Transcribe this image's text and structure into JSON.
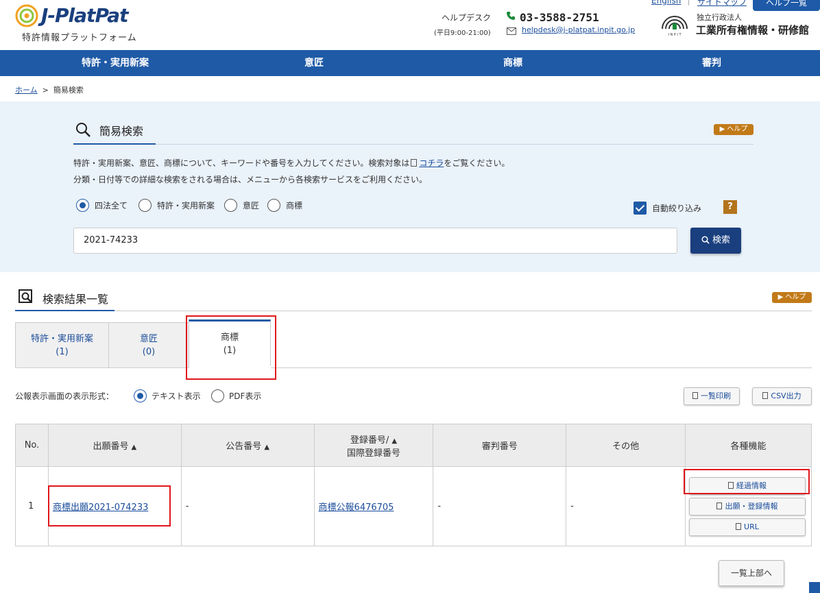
{
  "header": {
    "logo_text": "J-PlatPat",
    "logo_sub": "特許情報プラットフォーム",
    "helpdesk_label": "ヘルプデスク",
    "helpdesk_hours": "(平日9:00-21:00)",
    "phone": "03-3588-2751",
    "email": "helpdesk@j-platpat.inpit.go.jp",
    "top_link_1": "English",
    "top_link_2": "サイトマップ",
    "top_button": "ヘルプ一覧",
    "org_type": "独立行政法人",
    "org_name": "工業所有権情報・研修館"
  },
  "nav": {
    "items": [
      {
        "label": "特許・実用新案"
      },
      {
        "label": "意匠"
      },
      {
        "label": "商標"
      },
      {
        "label": "審判"
      }
    ]
  },
  "breadcrumb": {
    "home": "ホーム",
    "sep": ">",
    "current": "簡易検索"
  },
  "search": {
    "title": "簡易検索",
    "help": "▶ ヘルプ",
    "desc1_pre": "特許・実用新案、意匠、商標について、キーワードや番号を入力してください。検索対象は",
    "desc1_link": "コチラ",
    "desc1_post": "をご覧ください。",
    "desc2": "分類・日付等での詳細な検索をされる場合は、メニューから各検索サービスをご利用ください。",
    "radios": [
      {
        "label": "四法全て",
        "selected": true
      },
      {
        "label": "特許・実用新案",
        "selected": false
      },
      {
        "label": "意匠",
        "selected": false
      },
      {
        "label": "商標",
        "selected": false
      }
    ],
    "auto_narrow_label": "自動絞り込み",
    "auto_narrow_checked": true,
    "question": "?",
    "query": "2021-74233",
    "button": "検索"
  },
  "results": {
    "title": "検索結果一覧",
    "help": "▶ ヘルプ",
    "tabs": [
      {
        "label": "特許・実用新案",
        "count": "(1)",
        "active": false
      },
      {
        "label": "意匠",
        "count": "(0)",
        "active": false
      },
      {
        "label": "商標",
        "count": "(1)",
        "active": true
      }
    ],
    "format_label": "公報表示画面の表示形式：",
    "format_options": [
      {
        "label": "テキスト表示",
        "selected": true
      },
      {
        "label": "PDF表示",
        "selected": false
      }
    ],
    "print_button": "一覧印刷",
    "csv_button": "CSV出力",
    "columns": [
      "No.",
      "出願番号",
      "公告番号",
      "登録番号/",
      "国際登録番号",
      "審判番号",
      "その他",
      "各種機能"
    ],
    "sort_glyph": "▲",
    "rows": [
      {
        "no": "1",
        "application": "商標出願2021-074233",
        "publication": "-",
        "registration": "商標公報6476705",
        "appeal": "-",
        "other": "-",
        "actions": [
          "経過情報",
          "出願・登録情報",
          "URL"
        ]
      }
    ],
    "back_to_top": "一覧上部へ"
  },
  "colors": {
    "nav_blue": "#1f5aa6",
    "highlight_red": "#e0161b",
    "help_orange": "#c27a18"
  }
}
